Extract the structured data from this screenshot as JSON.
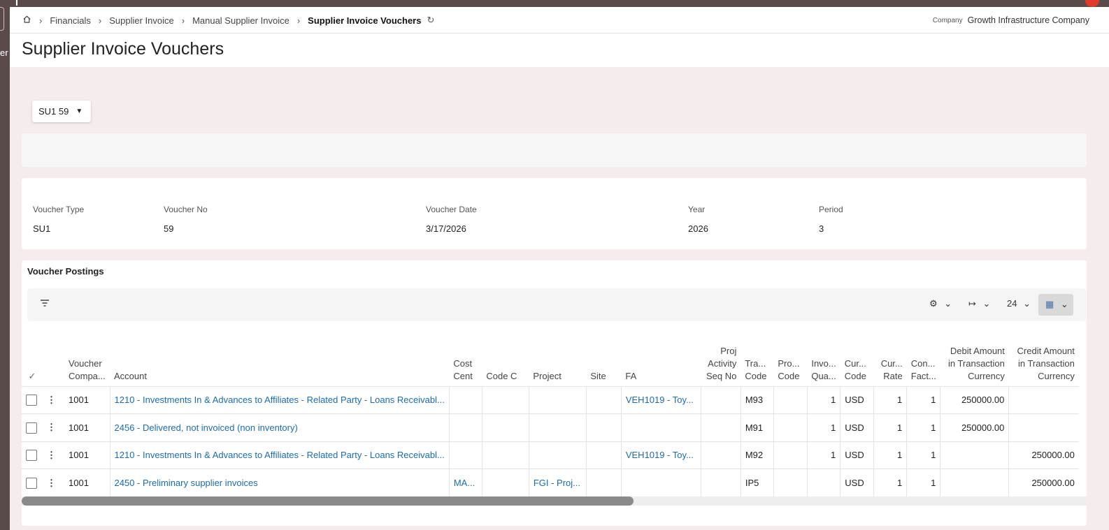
{
  "breadcrumb": {
    "items": [
      "Financials",
      "Supplier Invoice",
      "Manual Supplier Invoice"
    ],
    "current": "Supplier Invoice Vouchers"
  },
  "company": {
    "label": "Company",
    "value": "Growth Infrastructure Company"
  },
  "page_title": "Supplier Invoice Vouchers",
  "left_fragment": "er",
  "selector": {
    "value": "SU1 59"
  },
  "voucher": {
    "type_label": "Voucher Type",
    "type": "SU1",
    "no_label": "Voucher No",
    "no": "59",
    "date_label": "Voucher Date",
    "date": "3/17/2026",
    "year_label": "Year",
    "year": "2026",
    "period_label": "Period",
    "period": "3"
  },
  "postings": {
    "title": "Voucher Postings",
    "toolbar": {
      "page_size": "24"
    },
    "columns": {
      "voucher_company": [
        "Voucher",
        "Compa..."
      ],
      "account": "Account",
      "cost_center": [
        "Cost",
        "Cent"
      ],
      "code_c": "Code C",
      "project": "Project",
      "site": "Site",
      "fa": "FA",
      "proj_activity": [
        "Proj",
        "Activity",
        "Seq No"
      ],
      "trans_code": [
        "Tra...",
        "Code"
      ],
      "pro_code": [
        "Pro...",
        "Code"
      ],
      "invoice_qty": [
        "Invo...",
        "Qua..."
      ],
      "currency_code": [
        "Cur...",
        "Code"
      ],
      "currency_rate": [
        "Cur...",
        "Rate"
      ],
      "conv_factor": [
        "Con...",
        "Fact..."
      ],
      "debit": [
        "Debit Amount",
        "in Transaction",
        "Currency"
      ],
      "credit": [
        "Credit Amount",
        "in Transaction",
        "Currency"
      ]
    },
    "rows": [
      {
        "company": "1001",
        "account": "1210 - Investments In & Advances to Affiliates - Related Party - Loans Receivabl...",
        "cost_center": "",
        "code_c": "",
        "project": "",
        "site": "",
        "fa": "VEH1019 - Toy...",
        "proj_activity": "",
        "trans_code": "M93",
        "pro_code": "",
        "qty": "1",
        "currency": "USD",
        "rate": "1",
        "factor": "1",
        "debit": "250000.00",
        "credit": ""
      },
      {
        "company": "1001",
        "account": "2456 - Delivered, not invoiced (non inventory)",
        "cost_center": "",
        "code_c": "",
        "project": "",
        "site": "",
        "fa": "",
        "proj_activity": "",
        "trans_code": "M91",
        "pro_code": "",
        "qty": "1",
        "currency": "USD",
        "rate": "1",
        "factor": "1",
        "debit": "250000.00",
        "credit": ""
      },
      {
        "company": "1001",
        "account": "1210 - Investments In & Advances to Affiliates - Related Party - Loans Receivabl...",
        "cost_center": "",
        "code_c": "",
        "project": "",
        "site": "",
        "fa": "VEH1019 - Toy...",
        "proj_activity": "",
        "trans_code": "M92",
        "pro_code": "",
        "qty": "1",
        "currency": "USD",
        "rate": "1",
        "factor": "1",
        "debit": "",
        "credit": "250000.00"
      },
      {
        "company": "1001",
        "account": "2450 - Preliminary supplier invoices",
        "cost_center": "MA...",
        "code_c": "",
        "project": "FGI - Proj...",
        "site": "",
        "fa": "",
        "proj_activity": "",
        "trans_code": "IP5",
        "pro_code": "",
        "qty": "",
        "currency": "USD",
        "rate": "1",
        "factor": "1",
        "debit": "",
        "credit": "250000.00"
      }
    ]
  }
}
